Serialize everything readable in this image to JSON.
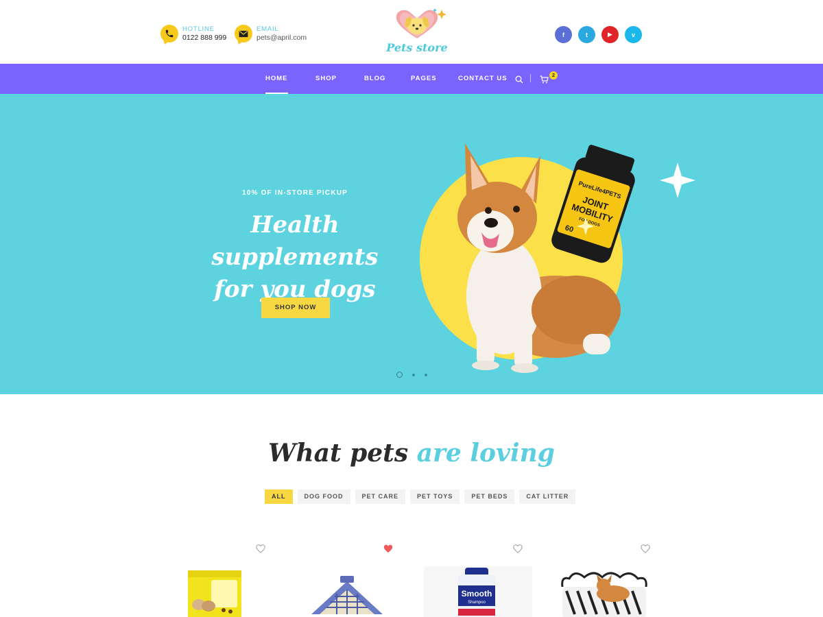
{
  "header": {
    "hotline": {
      "label": "HOTLINE",
      "value": "0122 888 999",
      "icon": "phone-icon"
    },
    "email": {
      "label": "EMAIL",
      "value": "pets@april.com",
      "icon": "envelope-icon"
    },
    "logo_text": "Pets store",
    "socials": [
      {
        "name": "facebook",
        "glyph": "f",
        "color": "#5b6fd6"
      },
      {
        "name": "twitter",
        "glyph": "t",
        "color": "#2aa8e0"
      },
      {
        "name": "youtube",
        "glyph": "▶",
        "color": "#e0242a"
      },
      {
        "name": "vimeo",
        "glyph": "v",
        "color": "#1ab7ea"
      }
    ]
  },
  "nav": {
    "items": [
      "HOME",
      "SHOP",
      "BLOG",
      "PAGES",
      "CONTACT US"
    ],
    "active": "HOME",
    "cart_count": "2",
    "background": "#7b63fd"
  },
  "hero": {
    "kicker": "10% OF IN-STORE PICKUP",
    "title_line1": "Health supplements",
    "title_line2": "for you dogs",
    "button": "SHOP NOW",
    "bottle_brand": "PureLife4PETS",
    "bottle_line1": "JOINT",
    "bottle_line2": "MOBILITY",
    "bottle_line3": "FOR DOGS",
    "bottle_count": "60",
    "background": "#5dd3e0",
    "slides_total": 3,
    "slide_active": 1
  },
  "section": {
    "title_main": "What pets ",
    "title_accent": "are loving",
    "filters": [
      "ALL",
      "DOG FOOD",
      "PET CARE",
      "PET TOYS",
      "PET BEDS",
      "CAT LITTER"
    ],
    "active_filter": "ALL"
  },
  "products": [
    {
      "name": "dog-food-bag",
      "favorite": false
    },
    {
      "name": "pet-house",
      "favorite": true
    },
    {
      "name": "smooth-shampoo",
      "label": "Smooth",
      "sublabel": "Shampoo",
      "favorite": false
    },
    {
      "name": "zebra-pet-bed",
      "favorite": false
    }
  ],
  "colors": {
    "accent_yellow": "#f7d742",
    "accent_cyan": "#5bcfe0",
    "heart_active": "#ef5b5b"
  }
}
